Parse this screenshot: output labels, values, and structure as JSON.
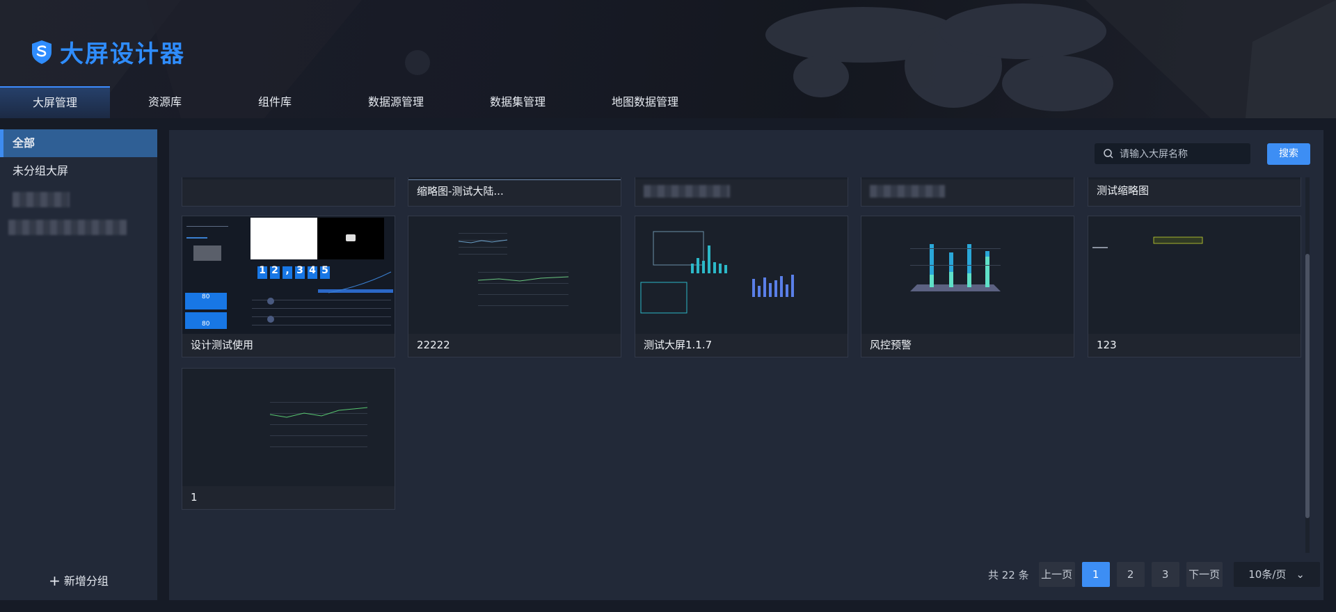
{
  "app": {
    "title": "大屏设计器"
  },
  "nav": {
    "items": [
      "大屏管理",
      "资源库",
      "组件库",
      "数据源管理",
      "数据集管理",
      "地图数据管理"
    ],
    "active": 0
  },
  "sidebar": {
    "items": [
      {
        "label": "全部",
        "active": true
      },
      {
        "label": "未分组大屏",
        "active": false
      }
    ],
    "add_group": "新增分组"
  },
  "search": {
    "placeholder": "请输入大屏名称",
    "button": "搜索"
  },
  "cards_top_row": [
    "",
    "缩略图-测试大陆...",
    "",
    "",
    "测试缩略图"
  ],
  "cards": [
    {
      "name": "设计测试使用"
    },
    {
      "name": "22222"
    },
    {
      "name": "测试大屏1.1.7"
    },
    {
      "name": "风控预警"
    },
    {
      "name": "123"
    },
    {
      "name": "1"
    }
  ],
  "thumb_texts": {
    "digits": [
      "1",
      "2",
      ",",
      "3",
      "4",
      "5"
    ],
    "card1_kpi": [
      "80",
      "80"
    ]
  },
  "pagination": {
    "total": "共 22 条",
    "prev": "上一页",
    "pages": [
      "1",
      "2",
      "3"
    ],
    "current": "1",
    "next": "下一页",
    "page_size": "10条/页"
  },
  "colors": {
    "accent": "#3d8ef4",
    "logo": "#2f8dff",
    "bg": "#161b26",
    "panel": "#222938"
  }
}
